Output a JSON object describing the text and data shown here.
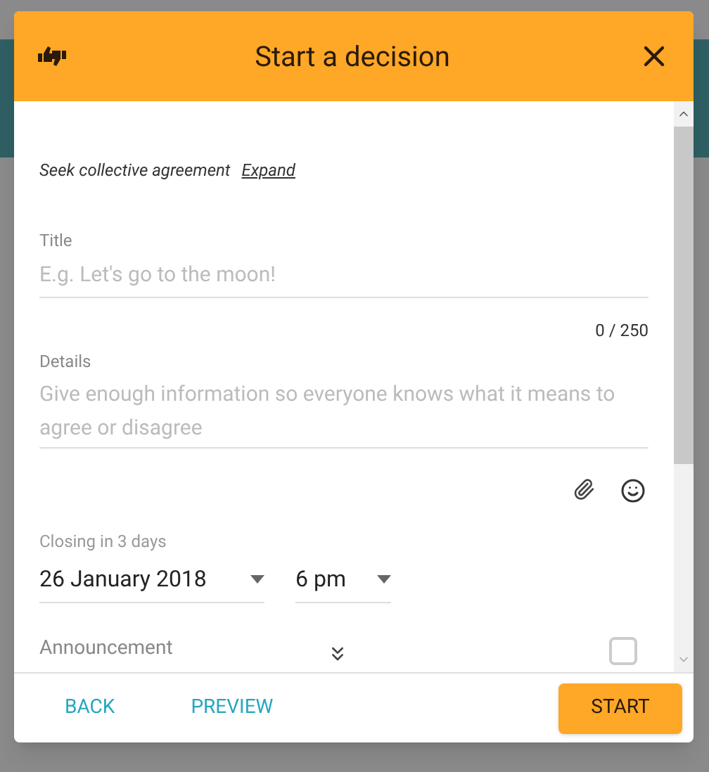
{
  "dialog": {
    "title": "Start a decision"
  },
  "subtitle": {
    "text": "Seek collective agreement",
    "link": "Expand"
  },
  "title_field": {
    "label": "Title",
    "placeholder": "E.g. Let's go to the moon!",
    "counter": "0 / 250"
  },
  "details_field": {
    "label": "Details",
    "placeholder": "Give enough information so everyone knows what it means to agree or disagree"
  },
  "closing": {
    "label": "Closing in 3 days",
    "date": "26 January 2018",
    "time": "6 pm"
  },
  "announcement": {
    "label": "Announcement",
    "checked": false
  },
  "buttons": {
    "back": "BACK",
    "preview": "PREVIEW",
    "start": "START"
  }
}
